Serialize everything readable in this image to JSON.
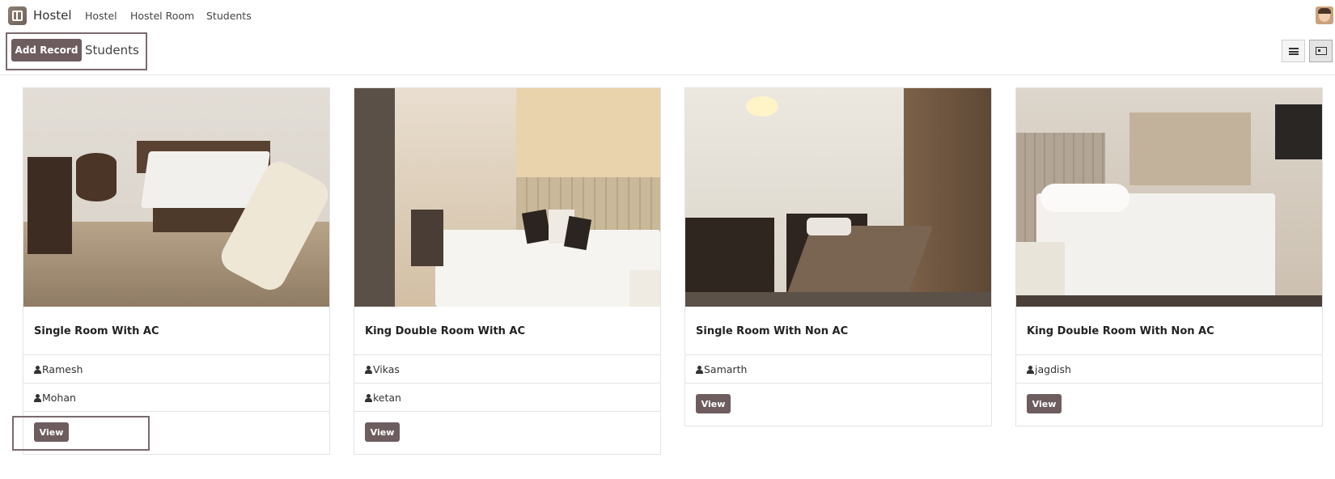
{
  "app": {
    "brand": "Hostel"
  },
  "nav": {
    "items": [
      "Hostel",
      "Hostel Room",
      "Students"
    ]
  },
  "control_panel": {
    "add_button": "Add Record",
    "breadcrumb": "Students"
  },
  "cards": [
    {
      "title": "Single Room With AC",
      "students": [
        "Ramesh",
        "Mohan"
      ],
      "view_label": "View"
    },
    {
      "title": "King Double Room With AC",
      "students": [
        "Vikas",
        "ketan"
      ],
      "view_label": "View"
    },
    {
      "title": "Single Room With Non AC",
      "students": [
        "Samarth"
      ],
      "view_label": "View"
    },
    {
      "title": "King Double Room With Non AC",
      "students": [
        "jagdish"
      ],
      "view_label": "View"
    }
  ],
  "colors": {
    "accent": "#6e5d5f",
    "border": "#e3e3e3"
  }
}
